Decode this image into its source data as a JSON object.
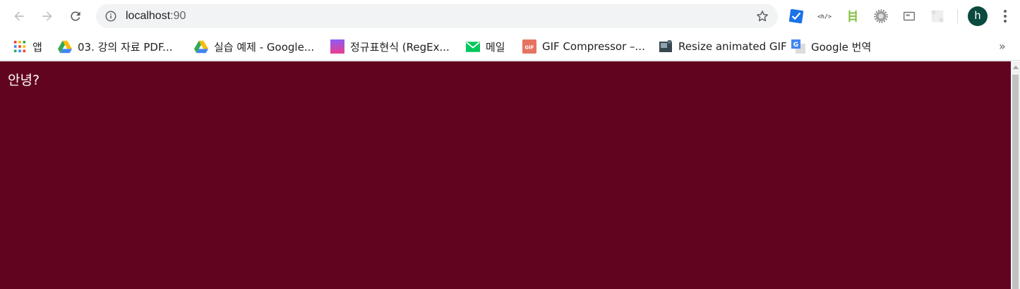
{
  "browser": {
    "address_bar": {
      "host": "localhost",
      "port": ":90"
    },
    "extensions": [
      "checklist-extension-icon",
      "code-tag-extension-icon",
      "ladder-extension-icon",
      "settings-extension-icon",
      "window-extension-icon",
      "placeholder-extension-icon"
    ],
    "profile_initial": "h"
  },
  "bookmarks": [
    {
      "label": "앱",
      "icon": "apps-grid-icon"
    },
    {
      "label": "03. 강의 자료 PDF...",
      "icon": "google-drive-icon"
    },
    {
      "label": "실습 예제 - Google...",
      "icon": "google-drive-icon"
    },
    {
      "label": "정규표현식 (RegEx...",
      "icon": "gradient-square-icon"
    },
    {
      "label": "메일",
      "icon": "mail-icon"
    },
    {
      "label": "GIF Compressor –...",
      "icon": "gif-icon"
    },
    {
      "label": "Resize animated GIF",
      "icon": "resize-tool-icon"
    },
    {
      "label": "Google 번역",
      "icon": "google-translate-icon"
    }
  ],
  "page": {
    "greeting": "안녕?",
    "background_color": "#61041f"
  }
}
